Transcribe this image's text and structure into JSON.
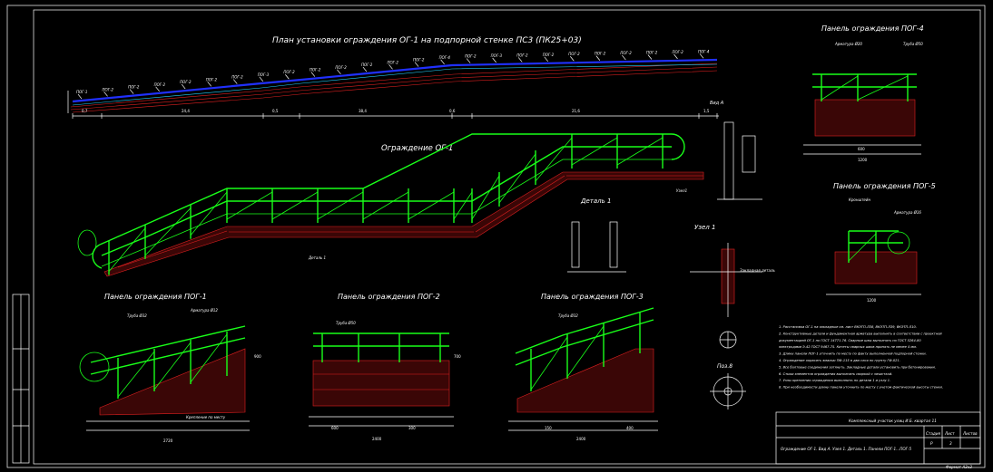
{
  "colors": {
    "background": "#000000",
    "railing": "#19ff19",
    "brick": "#e02020",
    "plan_guard": "#2030ff",
    "lines": "#ffffff"
  },
  "titles": {
    "plan": "План установки ограждения ОГ-1 на подпорной стенке ПС3 (ПК25+03)",
    "og1": "Ограждение ОГ-1",
    "pog1": "Панель ограждения ПОГ-1",
    "pog2": "Панель ограждения ПОГ-2",
    "pog3": "Панель ограждения ПОГ-3",
    "pog4": "Панель ограждения ПОГ-4",
    "pog5": "Панель ограждения ПОГ-5",
    "detail1": "Деталь 1",
    "node1": "Узел 1",
    "view_a": "Вид А",
    "pos8": "Поз.8"
  },
  "plan_labels": [
    "ПОГ-1",
    "ПОГ-2",
    "ПОГ-2",
    "ПОГ-2",
    "ПОГ-2",
    "ПОГ-2",
    "ПОГ-2",
    "ПОГ-3",
    "ПОГ-2",
    "ПОГ-2",
    "ПОГ-2",
    "ПОГ-2",
    "ПОГ-2",
    "ПОГ-2",
    "ПОГ-4",
    "ПОГ-2",
    "ПОГ-3",
    "ПОГ-2",
    "ПОГ-2",
    "ПОГ-2",
    "ПОГ-2",
    "ПОГ-2",
    "ПОГ-2",
    "ПОГ-2",
    "ПОГ-4"
  ],
  "plan_dims": [
    "0,7",
    "24,4",
    "0,5",
    "38,4",
    "0,6",
    "21,6",
    "1,5"
  ],
  "callouts": {
    "arm": "Арматура Ø20",
    "arm2": "Арматура Ø16",
    "arm3": "Арматура Ø12",
    "pipe": "Труба Ø50",
    "pipe2": "Труба Ø32",
    "bracket": "Кронштейн",
    "detail1": "Деталь 1",
    "node1": "Узел1",
    "anchor": "Закладная деталь",
    "embed": "Крепление по месту"
  },
  "notes": [
    "1. Расстановка ОГ-1 на закладные см. лист ВКЭТП-ЛЗ8, ВКЭТП-ЛЗ9, ВКЭТП-Л10.",
    "2. Конструктивные детали и фундаментная арматура выполнить в соответствии с проектной",
    "документацией ОГ-1 по ГОСТ 14771-76. Сварные швы выполнять по ГОСТ 5264-80",
    "электродами Э-42 ГОСТ 9467-75. Катеты сварных швов принять не менее 4 мм.",
    "3. Длину панели ПОГ-1 уточнить по месту по факту выполненной подпорной стенки.",
    "4. Ограждение окрасить эмалью ПФ-115 в два слоя по грунту ГФ-021.",
    "5. Все болтовые соединения затянуть. Закладные детали установить при бетонировании.",
    "6. Стыки элементов ограждения выполнить сваркой с зачисткой.",
    "7. Узлы крепления ограждения выполнить по детали 1 и узлу 1.",
    "8. При необходимости длину панели уточнить по месту с учетом фактической высоты стенки."
  ],
  "title_block": {
    "project": "Комплексный участок улиц И.Б. квартал 11",
    "content": "Ограждение ОГ-1. Вид А. Узел 1. Деталь 1. Панели ПОГ-1...ПОГ-5",
    "stage_h": "Стадия",
    "sheet_h": "Лист",
    "sheets_h": "Листов",
    "stage": "Р",
    "sheet": "3",
    "sheets": "",
    "format": "Формат А3х3"
  },
  "dims": {
    "pog1_w": "2720",
    "pog2_w": "2400",
    "pog3_w": "2400",
    "pog4_w": "1200",
    "pog4_w2": "600",
    "pog5_w": "1200",
    "h1": "900",
    "h2": "700",
    "s1": "600",
    "s2": "300",
    "s3": "150",
    "s4": "400"
  }
}
